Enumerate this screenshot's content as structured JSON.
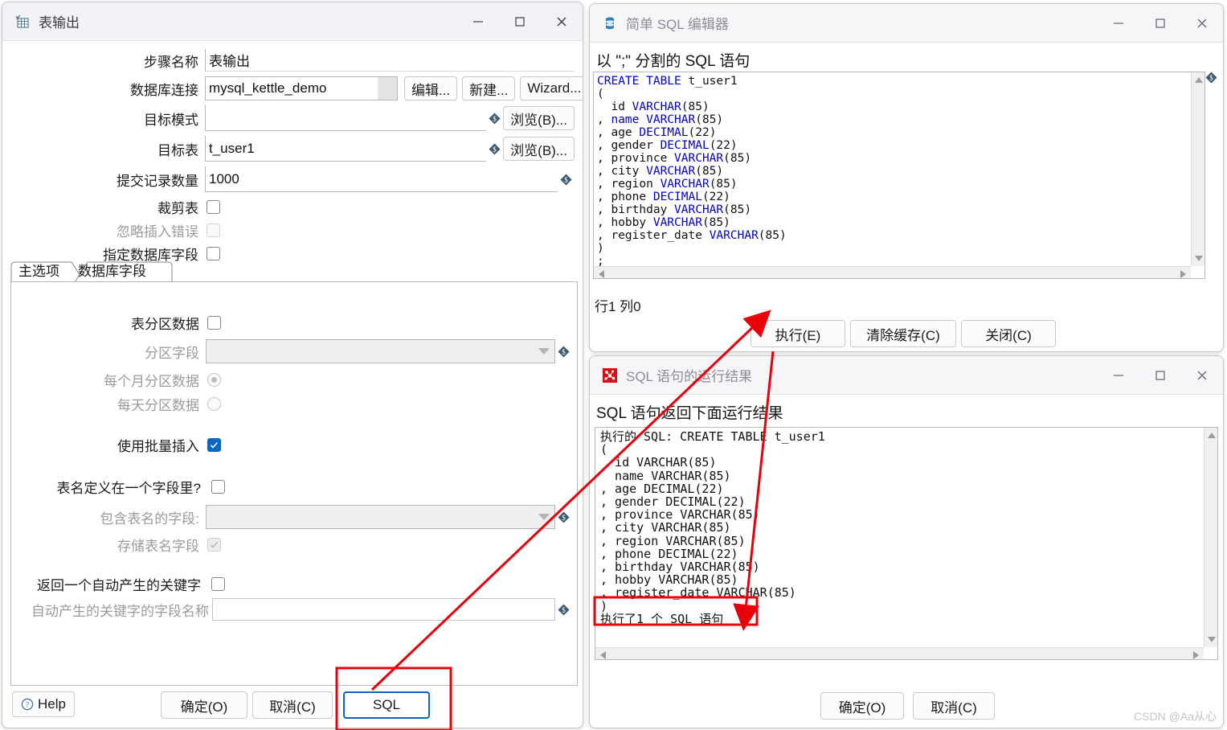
{
  "table_output_dialog": {
    "title": "表输出",
    "icon": "table-output-icon",
    "window_controls": {
      "minimize": "–",
      "maximize": "□",
      "close": "✕"
    },
    "fields": {
      "step_name_label": "步骤名称",
      "step_name_value": "表输出",
      "db_connection_label": "数据库连接",
      "db_connection_value": "mysql_kettle_demo",
      "edit_button": "编辑...",
      "new_button": "新建...",
      "wizard_button": "Wizard...",
      "target_schema_label": "目标模式",
      "target_schema_value": "",
      "target_schema_browse": "浏览(B)...",
      "target_table_label": "目标表",
      "target_table_value": "t_user1",
      "target_table_browse": "浏览(B)...",
      "commit_size_label": "提交记录数量",
      "commit_size_value": "1000",
      "truncate_table_label": "裁剪表",
      "ignore_insert_errors_label": "忽略插入错误",
      "specify_db_fields_label": "指定数据库字段"
    },
    "tabs": [
      {
        "label": "主选项",
        "selected": true
      },
      {
        "label": "数据库字段",
        "selected": false
      }
    ],
    "main_options": {
      "partition_data_label": "表分区数据",
      "partition_field_label": "分区字段",
      "partition_field_value": "",
      "partition_monthly_label": "每个月分区数据",
      "partition_daily_label": "每天分区数据",
      "use_batch_insert_label": "使用批量插入",
      "table_name_in_field_label": "表名定义在一个字段里?",
      "field_with_table_name_label": "包含表名的字段:",
      "field_with_table_name_value": "",
      "store_table_name_field_label": "存储表名字段",
      "return_auto_key_label": "返回一个自动产生的关键字",
      "auto_key_field_name_label": "自动产生的关键字的字段名称",
      "auto_key_field_name_value": ""
    },
    "buttons": {
      "help": "Help",
      "ok": "确定(O)",
      "cancel": "取消(C)",
      "sql": "SQL"
    }
  },
  "sql_editor_dialog": {
    "title": "简单 SQL 编辑器",
    "icon": "database-icon",
    "header": "以 \";\" 分割的 SQL 语句",
    "sql_lines": [
      {
        "text": "CREATE TABLE t_user1",
        "tokens": [
          [
            "kw",
            "CREATE TABLE"
          ],
          [
            "pl",
            " t_user1"
          ]
        ]
      },
      {
        "text": "(",
        "tokens": [
          [
            "pl",
            "("
          ]
        ]
      },
      {
        "text": "  id VARCHAR(85)",
        "tokens": [
          [
            "pl",
            "  id "
          ],
          [
            "ty",
            "VARCHAR"
          ],
          [
            "pl",
            "(85)"
          ]
        ]
      },
      {
        "text": ", name VARCHAR(85)",
        "tokens": [
          [
            "pl",
            ", "
          ],
          [
            "ty",
            "name VARCHAR"
          ],
          [
            "pl",
            "(85)"
          ]
        ]
      },
      {
        "text": ", age DECIMAL(22)",
        "tokens": [
          [
            "pl",
            ", age "
          ],
          [
            "ty",
            "DECIMAL"
          ],
          [
            "pl",
            "(22)"
          ]
        ]
      },
      {
        "text": ", gender DECIMAL(22)",
        "tokens": [
          [
            "pl",
            ", gender "
          ],
          [
            "ty",
            "DECIMAL"
          ],
          [
            "pl",
            "(22)"
          ]
        ]
      },
      {
        "text": ", province VARCHAR(85)",
        "tokens": [
          [
            "pl",
            ", province "
          ],
          [
            "ty",
            "VARCHAR"
          ],
          [
            "pl",
            "(85)"
          ]
        ]
      },
      {
        "text": ", city VARCHAR(85)",
        "tokens": [
          [
            "pl",
            ", city "
          ],
          [
            "ty",
            "VARCHAR"
          ],
          [
            "pl",
            "(85)"
          ]
        ]
      },
      {
        "text": ", region VARCHAR(85)",
        "tokens": [
          [
            "pl",
            ", region "
          ],
          [
            "ty",
            "VARCHAR"
          ],
          [
            "pl",
            "(85)"
          ]
        ]
      },
      {
        "text": ", phone DECIMAL(22)",
        "tokens": [
          [
            "pl",
            ", phone "
          ],
          [
            "ty",
            "DECIMAL"
          ],
          [
            "pl",
            "(22)"
          ]
        ]
      },
      {
        "text": ", birthday VARCHAR(85)",
        "tokens": [
          [
            "pl",
            ", birthday "
          ],
          [
            "ty",
            "VARCHAR"
          ],
          [
            "pl",
            "(85)"
          ]
        ]
      },
      {
        "text": ", hobby VARCHAR(85)",
        "tokens": [
          [
            "pl",
            ", hobby "
          ],
          [
            "ty",
            "VARCHAR"
          ],
          [
            "pl",
            "(85)"
          ]
        ]
      },
      {
        "text": ", register_date VARCHAR(85)",
        "tokens": [
          [
            "pl",
            ", register_date "
          ],
          [
            "ty",
            "VARCHAR"
          ],
          [
            "pl",
            "(85)"
          ]
        ]
      },
      {
        "text": ")",
        "tokens": [
          [
            "pl",
            ")"
          ]
        ]
      },
      {
        "text": ";",
        "tokens": [
          [
            "pl",
            ";"
          ]
        ]
      }
    ],
    "status": "行1 列0",
    "buttons": {
      "execute": "执行(E)",
      "clear_cache": "清除缓存(C)",
      "close": "关闭(C)"
    }
  },
  "sql_result_dialog": {
    "title": "SQL 语句的运行结果",
    "icon": "sql-result-icon",
    "header": "SQL 语句返回下面运行结果",
    "result_lines": [
      "执行的 SQL: CREATE TABLE t_user1",
      "(",
      "  id VARCHAR(85)",
      "  name VARCHAR(85)",
      ", age DECIMAL(22)",
      ", gender DECIMAL(22)",
      ", province VARCHAR(85)",
      ", city VARCHAR(85)",
      ", region VARCHAR(85)",
      ", phone DECIMAL(22)",
      ", birthday VARCHAR(85)",
      ", hobby VARCHAR(85)",
      ", register_date VARCHAR(85)",
      ")",
      "执行了1 个 SQL 语句"
    ],
    "highlighted_line": "执行了1 个 SQL 语句",
    "buttons": {
      "ok": "确定(O)",
      "cancel": "取消(C)"
    }
  },
  "annotations": {
    "color": "#e8000b",
    "highlight_boxes": [
      "sql-button-box",
      "executed-statement-box"
    ],
    "arrows": [
      "sql-button-to-execute",
      "execute-to-result"
    ]
  },
  "watermark": "CSDN @Aa从心"
}
